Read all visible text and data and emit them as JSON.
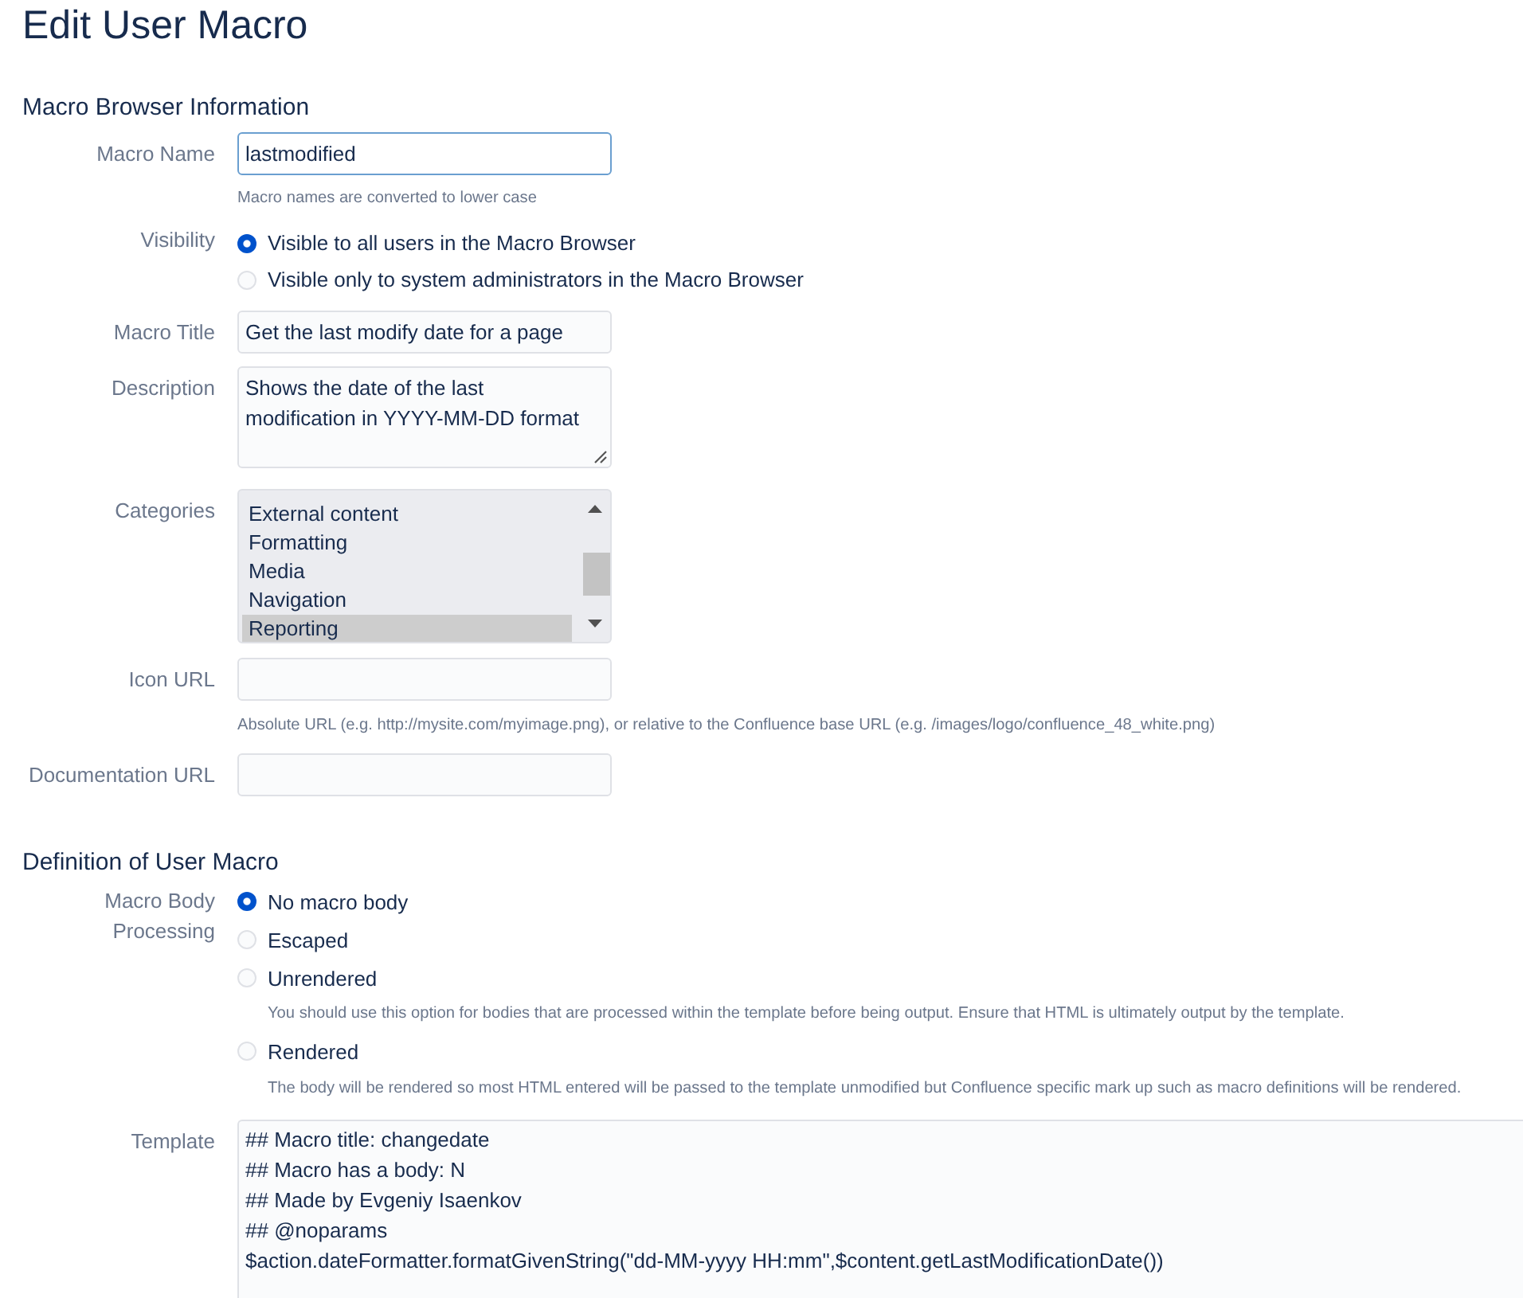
{
  "title": "Edit User Macro",
  "macro_browser_information": {
    "heading": "Macro Browser Information",
    "macro_name": {
      "label": "Macro Name",
      "value": "lastmodified",
      "focused": true,
      "help": "Macro names are converted to lower case"
    },
    "visibility": {
      "label": "Visibility",
      "options": [
        {
          "label": "Visible to all users in the Macro Browser",
          "selected": true
        },
        {
          "label": "Visible only to system administrators in the Macro Browser",
          "selected": false
        }
      ]
    },
    "macro_title": {
      "label": "Macro Title",
      "value": "Get the last modify date for a page"
    },
    "description": {
      "label": "Description",
      "value": "Shows the date of the last modification in YYYY-MM-DD format"
    },
    "categories": {
      "label": "Categories",
      "items": [
        {
          "label": "External content",
          "selected": false
        },
        {
          "label": "Formatting",
          "selected": false
        },
        {
          "label": "Media",
          "selected": false
        },
        {
          "label": "Navigation",
          "selected": false
        },
        {
          "label": "Reporting",
          "selected": true
        }
      ]
    },
    "icon_url": {
      "label": "Icon URL",
      "help": "Absolute URL (e.g. http://mysite.com/myimage.png), or relative to the Confluence base URL (e.g. /images/logo/confluence_48_white.png)"
    },
    "documentation_url": {
      "label": "Documentation URL"
    }
  },
  "definition_of_user_macro": {
    "heading": "Definition of User Macro",
    "macro_body_processing": {
      "label": "Macro Body Processing",
      "options": [
        {
          "label": "No macro body",
          "selected": true
        },
        {
          "label": "Escaped",
          "selected": false
        },
        {
          "label": "Unrendered",
          "selected": false,
          "help": "You should use this option for bodies that are processed within the template before being output. Ensure that HTML is ultimately output by the template."
        },
        {
          "label": "Rendered",
          "selected": false,
          "help": "The body will be rendered so most HTML entered will be passed to the template unmodified but Confluence specific mark up such as macro definitions will be rendered."
        }
      ]
    },
    "template": {
      "label": "Template",
      "lines": [
        "## Macro title: changedate",
        "## Macro has a body: N",
        "## Made by Evgeniy Isaenkov",
        "## @noparams",
        "$action.dateFormatter.formatGivenString(\"dd-MM-yyyy HH:mm\",$content.getLastModificationDate())"
      ]
    }
  }
}
